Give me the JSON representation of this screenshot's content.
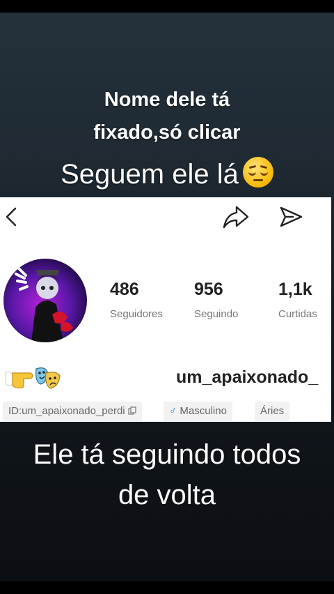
{
  "captions": {
    "line1": "Nome dele tá",
    "line2": "fixado,só clicar",
    "line3": "Seguem ele lá",
    "bottom1": "Ele tá seguindo todos",
    "bottom2": "de volta"
  },
  "profile": {
    "stats": [
      {
        "value": "486",
        "label": "Seguidores"
      },
      {
        "value": "956",
        "label": "Seguindo"
      },
      {
        "value": "1,1k",
        "label": "Curtidas"
      }
    ],
    "username": "um_apaixonado_",
    "tags": {
      "id": "ID:um_apaixonado_perdi",
      "gender_symbol": "♂",
      "gender": "Masculino",
      "sign": "Áries"
    }
  },
  "icons": [
    "back-arrow-icon",
    "share-icon",
    "send-icon",
    "pensive-face-emoji",
    "pointing-hand-emoji",
    "performing-arts-emoji",
    "copy-icon"
  ]
}
